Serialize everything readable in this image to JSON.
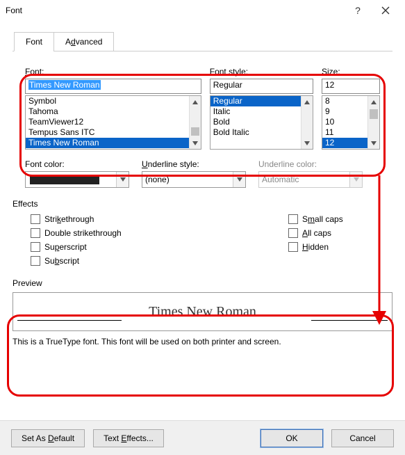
{
  "window": {
    "title": "Font"
  },
  "tabs": {
    "font": "Font",
    "advanced_pre": "A",
    "advanced_u": "d",
    "advanced_post": "vanced"
  },
  "labels": {
    "font_pre": "",
    "font_u": "F",
    "font_post": "ont:",
    "style": "Font style:",
    "size_pre": "",
    "size_u": "S",
    "size_post": "ize:",
    "fontcolor": "Font color:",
    "underline_pre": "",
    "underline_u": "U",
    "underline_post": "nderline style:",
    "underlinecolor": "Underline color:",
    "effects": "Effects",
    "preview": "Preview"
  },
  "font": {
    "value": "Times New Roman",
    "list": [
      "Symbol",
      "Tahoma",
      "TeamViewer12",
      "Tempus Sans ITC",
      "Times New Roman"
    ],
    "selected_index": 4
  },
  "style": {
    "value": "Regular",
    "list": [
      "Regular",
      "Italic",
      "Bold",
      "Bold Italic"
    ],
    "selected_index": 0
  },
  "size": {
    "value": "12",
    "list": [
      "8",
      "9",
      "10",
      "11",
      "12"
    ],
    "selected_index": 4
  },
  "underline": {
    "value": "(none)"
  },
  "underline_color": {
    "value": "Automatic"
  },
  "effects_items": {
    "strike_pre": "Stri",
    "strike_u": "k",
    "strike_post": "ethrough",
    "dstrike": "Double strikethrough",
    "super_pre": "Su",
    "super_u": "p",
    "super_post": "erscript",
    "sub_pre": "Su",
    "sub_u": "b",
    "sub_post": "script",
    "scaps_pre": "S",
    "scaps_u": "m",
    "scaps_post": "all caps",
    "acaps_pre": "",
    "acaps_u": "A",
    "acaps_post": "ll caps",
    "hidden_pre": "",
    "hidden_u": "H",
    "hidden_post": "idden"
  },
  "preview": {
    "text": "Times New Roman",
    "info": "This is a TrueType font. This font will be used on both printer and screen."
  },
  "buttons": {
    "default_pre": "Set As ",
    "default_u": "D",
    "default_post": "efault",
    "texteffects_pre": "Text ",
    "texteffects_u": "E",
    "texteffects_post": "ffects...",
    "ok": "OK",
    "cancel": "Cancel"
  }
}
